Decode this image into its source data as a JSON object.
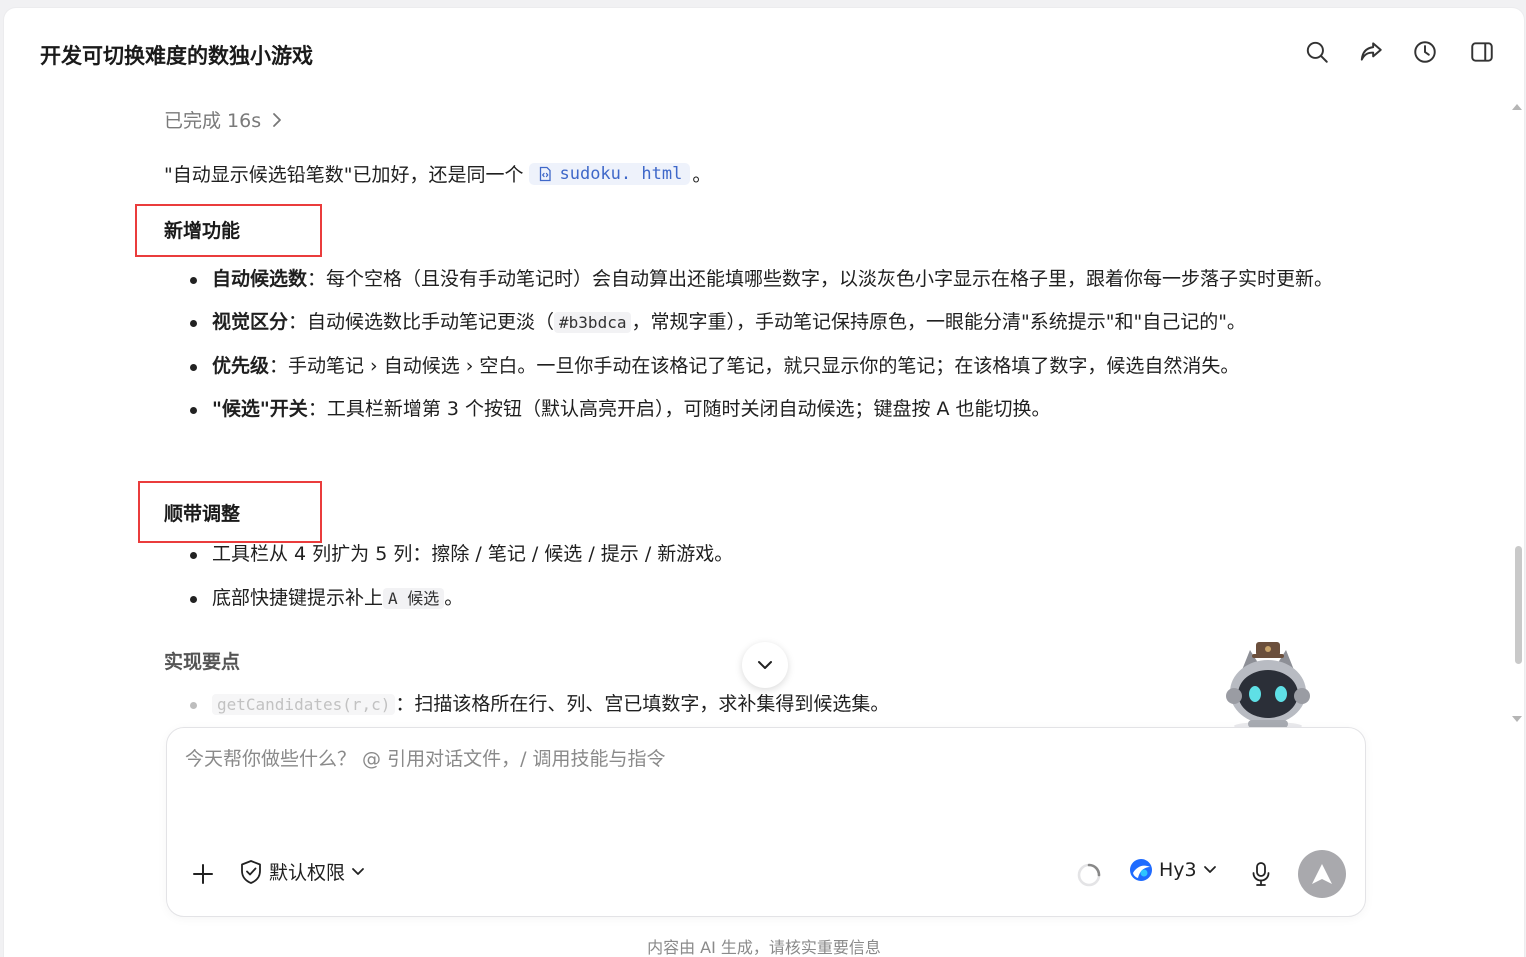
{
  "header": {
    "title": "开发可切换难度的数独小游戏",
    "icons": [
      "search-icon",
      "share-icon",
      "history-icon",
      "sidebar-toggle-icon"
    ]
  },
  "message": {
    "thought_label": "已完成 16s",
    "intro_before": "\"自动显示候选铅笔数\"已加好，还是同一个",
    "file_name": "sudoku. html",
    "intro_after": "。",
    "section_new": {
      "title": "新增功能",
      "items": [
        {
          "bold": "自动候选数",
          "text": "：每个空格（且没有手动笔记时）会自动算出还能填哪些数字，以淡灰色小字显示在格子里，跟着你每一步落子实时更新。"
        },
        {
          "bold": "视觉区分",
          "text_a": "：自动候选数比手动笔记更淡（",
          "code": "#b3bdca",
          "text_b": "，常规字重），手动笔记保持原色，一眼能分清\"系统提示\"和\"自己记的\"。"
        },
        {
          "bold": "优先级",
          "text": "：手动笔记 › 自动候选 › 空白。一旦你手动在该格记了笔记，就只显示你的笔记；在该格填了数字，候选自然消失。"
        },
        {
          "bold": "\"候选\"开关",
          "text": "：工具栏新增第 3 个按钮（默认高亮开启），可随时关闭自动候选；键盘按 A 也能切换。"
        }
      ]
    },
    "section_adjust": {
      "title": "顺带调整",
      "items": [
        {
          "text": "工具栏从 4 列扩为 5 列：擦除 / 笔记 / 候选 / 提示 / 新游戏。"
        },
        {
          "text_a": "底部快捷键提示补上",
          "code": "A 候选",
          "text_b": "。"
        }
      ]
    },
    "section_impl": {
      "title": "实现要点",
      "items": [
        {
          "code": "getCandidates(r,c)",
          "text": "：扫描该格所在行、列、宫已填数字，求补集得到候选集。"
        }
      ]
    }
  },
  "composer": {
    "placeholder": "今天帮你做些什么？ @ 引用对话文件，/ 调用技能与指令",
    "permission_label": "默认权限",
    "model_label": "Hy3"
  },
  "footer": {
    "disclaimer": "内容由 AI 生成，请核实重要信息"
  },
  "colors": {
    "highlight_box": "#ea3c3c",
    "file_chip_text": "#3f68c9",
    "send_button": "#a9a9ad"
  }
}
